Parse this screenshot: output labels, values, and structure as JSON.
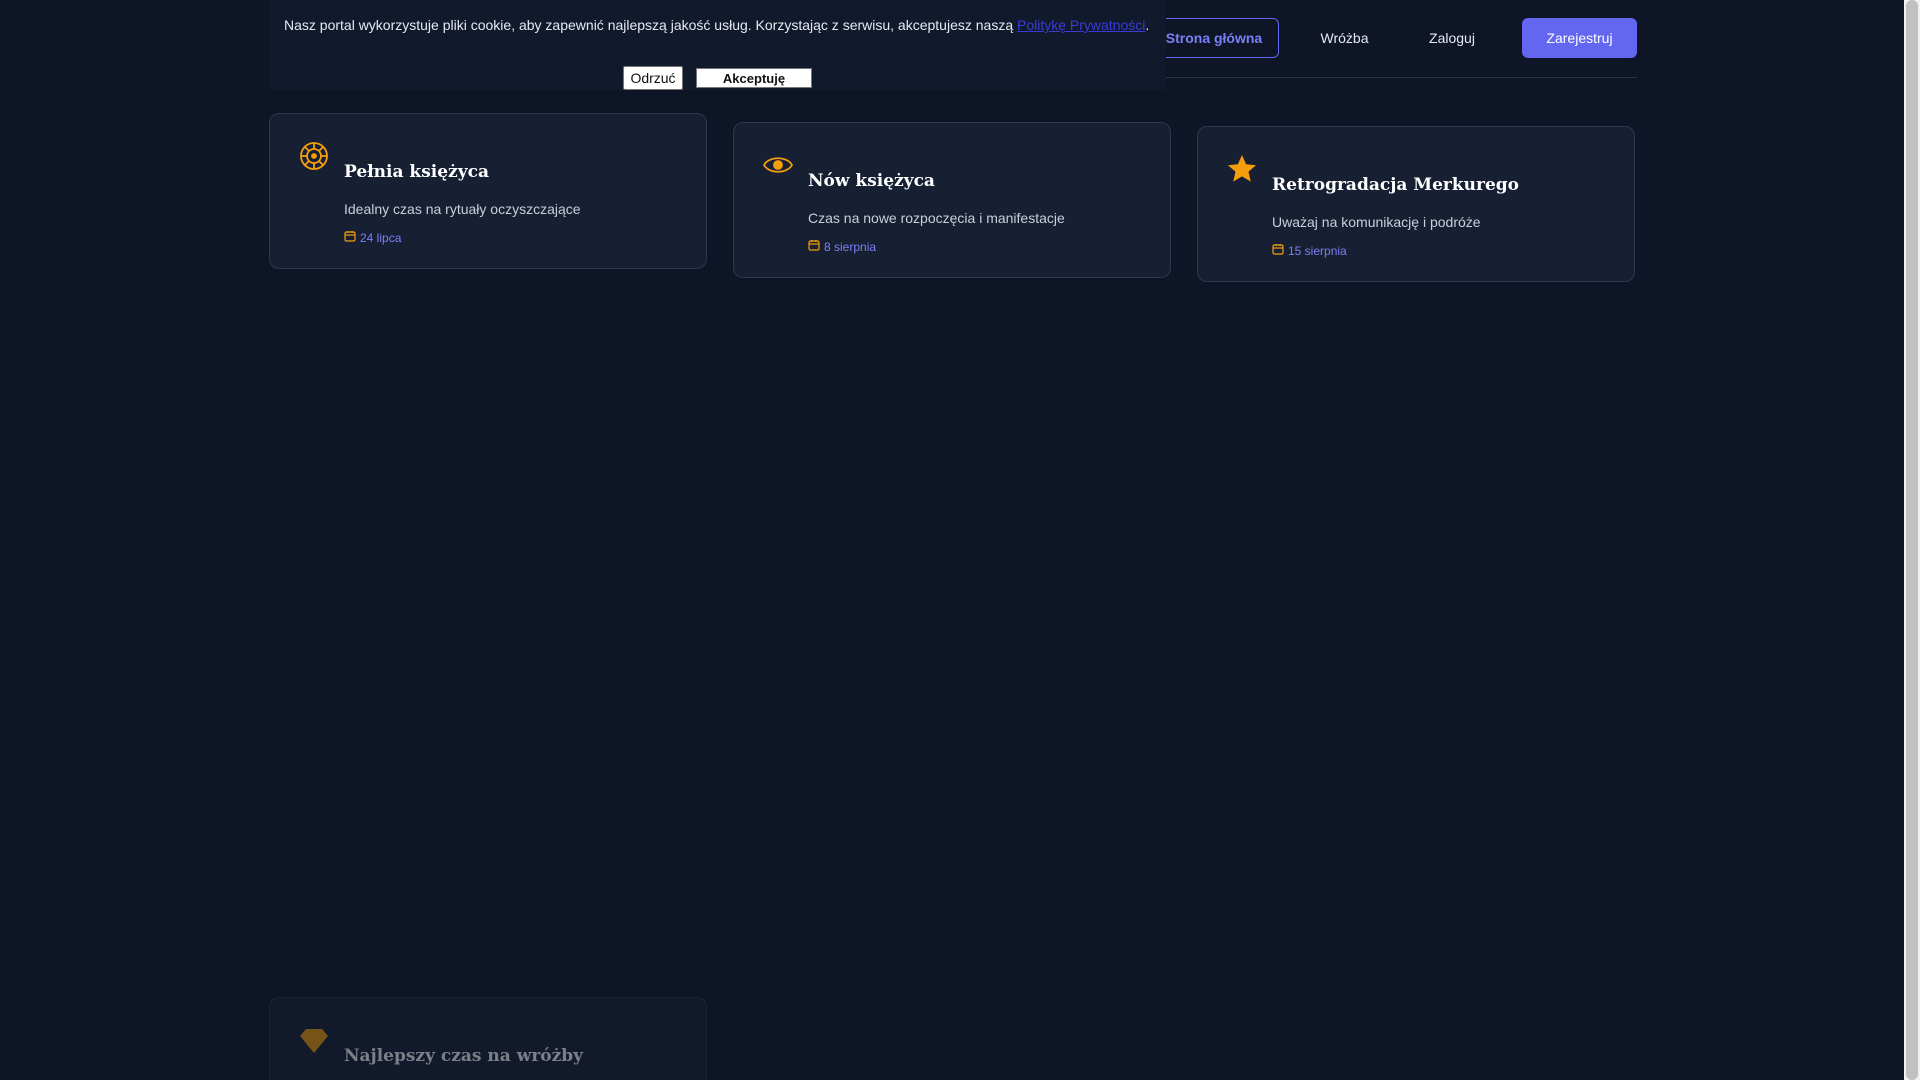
{
  "nav": {
    "home": "Strona główna",
    "wrozba": "Wróżba",
    "login": "Zaloguj",
    "register": "Zarejestruj"
  },
  "cookie": {
    "text": "Nasz portal wykorzystuje pliki cookie, aby zapewnić najlepszą jakość usług. Korzystając z serwisu, akceptujesz naszą ",
    "link": "Politykę Prywatności",
    "end": ".",
    "decline": "Odrzuć",
    "accept": "Akceptuję"
  },
  "cards": [
    {
      "icon": "sun-wheel-icon",
      "title": "Pełnia księżyca",
      "desc": "Idealny czas na rytuały oczyszczające",
      "date": "24 lipca"
    },
    {
      "icon": "eye-icon",
      "title": "Nów księżyca",
      "desc": "Czas na nowe rozpoczęcia i manifestacje",
      "date": "8 sierpnia"
    },
    {
      "icon": "star-icon",
      "title": "Retrogradacja Merkurego",
      "desc": "Uważaj na komunikację i podróże",
      "date": "15 sierpnia"
    },
    {
      "icon": "gem-icon",
      "title": "Najlepszy czas na wróżby"
    }
  ],
  "colors": {
    "background": "#0d1526",
    "card": "#172033",
    "accent": "#6366f1",
    "icon": "#f59e0b"
  }
}
